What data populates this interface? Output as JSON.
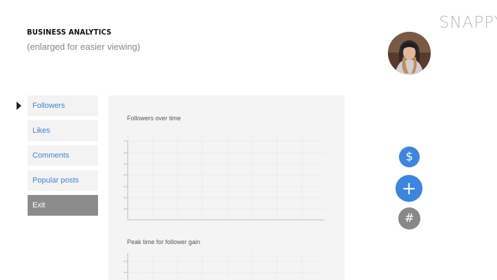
{
  "brand": "SNAPPY",
  "header": {
    "title": "BUSINESS ANALYTICS",
    "subtitle": "(enlarged for easier viewing)"
  },
  "nav": {
    "items": [
      {
        "label": "Followers"
      },
      {
        "label": "Likes"
      },
      {
        "label": "Comments"
      },
      {
        "label": "Popular posts"
      },
      {
        "label": "Exit"
      }
    ]
  },
  "charts": {
    "followers_title": "Followers over time",
    "peak_title": "Peak time for follower gain"
  },
  "actions": {
    "dollar_icon": "$",
    "plus_icon": "+",
    "hash_icon": "#"
  },
  "colors": {
    "accent": "#3a86e0",
    "exit": "#8c8c8c",
    "neutral_fab": "#888888"
  }
}
